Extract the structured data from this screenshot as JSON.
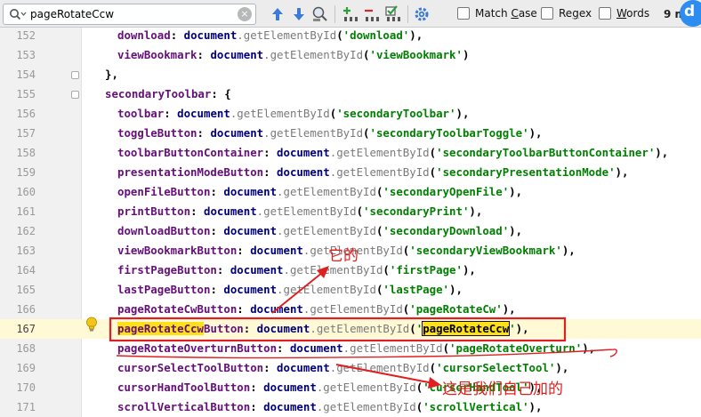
{
  "search": {
    "query": "pageRotateCcw",
    "clear_glyph": "×",
    "icons": [
      "search-icon",
      "arrow-up-icon",
      "arrow-down-icon",
      "find-usages-icon",
      "add-selection-icon",
      "remove-selection-icon",
      "select-all-occurrences-icon",
      "settings-icon"
    ]
  },
  "options": {
    "match_case": {
      "pre": "Match ",
      "u": "C",
      "post": "ase"
    },
    "regex": {
      "pre": "Re",
      "u": "g",
      "post": "ex"
    },
    "words": {
      "pre": "",
      "u": "W",
      "post": "ords"
    }
  },
  "match_count": "9 m",
  "avatar_letter": "d",
  "colors": {
    "property": "#660e7a",
    "object": "#000080",
    "method": "#7a7a7a",
    "string": "#008000",
    "match_highlight": "#ffe119",
    "annotation": "#e02020"
  },
  "lines": [
    {
      "num": "152",
      "indent": 2,
      "prop": "download",
      "str": "'download'",
      "end": "),"
    },
    {
      "num": "153",
      "indent": 2,
      "prop": "viewBookmark",
      "str": "'viewBookmark'",
      "end": ")"
    },
    {
      "num": "154",
      "indent": 1,
      "plain": "},"
    },
    {
      "num": "155",
      "indent": 1,
      "prop": "secondaryToolbar",
      "plain_after": ": {"
    },
    {
      "num": "156",
      "indent": 2,
      "prop": "toolbar",
      "str": "'secondaryToolbar'",
      "end": "),"
    },
    {
      "num": "157",
      "indent": 2,
      "prop": "toggleButton",
      "str": "'secondaryToolbarToggle'",
      "end": "),"
    },
    {
      "num": "158",
      "indent": 2,
      "prop": "toolbarButtonContainer",
      "str": "'secondaryToolbarButtonContainer'",
      "end": "),"
    },
    {
      "num": "159",
      "indent": 2,
      "prop": "presentationModeButton",
      "str": "'secondaryPresentationMode'",
      "end": "),"
    },
    {
      "num": "160",
      "indent": 2,
      "prop": "openFileButton",
      "str": "'secondaryOpenFile'",
      "end": "),"
    },
    {
      "num": "161",
      "indent": 2,
      "prop": "printButton",
      "str": "'secondaryPrint'",
      "end": "),"
    },
    {
      "num": "162",
      "indent": 2,
      "prop": "downloadButton",
      "str": "'secondaryDownload'",
      "end": "),"
    },
    {
      "num": "163",
      "indent": 2,
      "prop": "viewBookmarkButton",
      "str": "'secondaryViewBookmark'",
      "end": "),"
    },
    {
      "num": "164",
      "indent": 2,
      "prop": "firstPageButton",
      "str": "'firstPage'",
      "end": "),"
    },
    {
      "num": "165",
      "indent": 2,
      "prop": "lastPageButton",
      "str": "'lastPage'",
      "end": "),"
    },
    {
      "num": "166",
      "indent": 2,
      "prop": "pageRotateCwButton",
      "str": "'pageRotateCw'",
      "end": "),"
    },
    {
      "num": "167",
      "indent": 2,
      "prop": "pageRotateCcwButton",
      "str": "'pageRotateCcw'",
      "end": "),",
      "current": true
    },
    {
      "num": "168",
      "indent": 2,
      "prop": "pageRotateOverturnButton",
      "str": "'pageRotateOverturn'",
      "end": "),"
    },
    {
      "num": "169",
      "indent": 2,
      "prop": "cursorSelectToolButton",
      "str": "'cursorSelectTool'",
      "end": "),"
    },
    {
      "num": "170",
      "indent": 2,
      "prop": "cursorHandToolButton",
      "str": "'cursorHandTool'",
      "end": "),"
    },
    {
      "num": "171",
      "indent": 2,
      "prop": "scrollVerticalButton",
      "str": "'scrollVertical'",
      "end": "),"
    }
  ],
  "tokens": {
    "colon_doc": ": ",
    "document": "document",
    "dot_get": ".getElementById",
    "paren": "("
  },
  "annotations": {
    "theirs": "它的",
    "ours": "这是我们自己加的"
  }
}
